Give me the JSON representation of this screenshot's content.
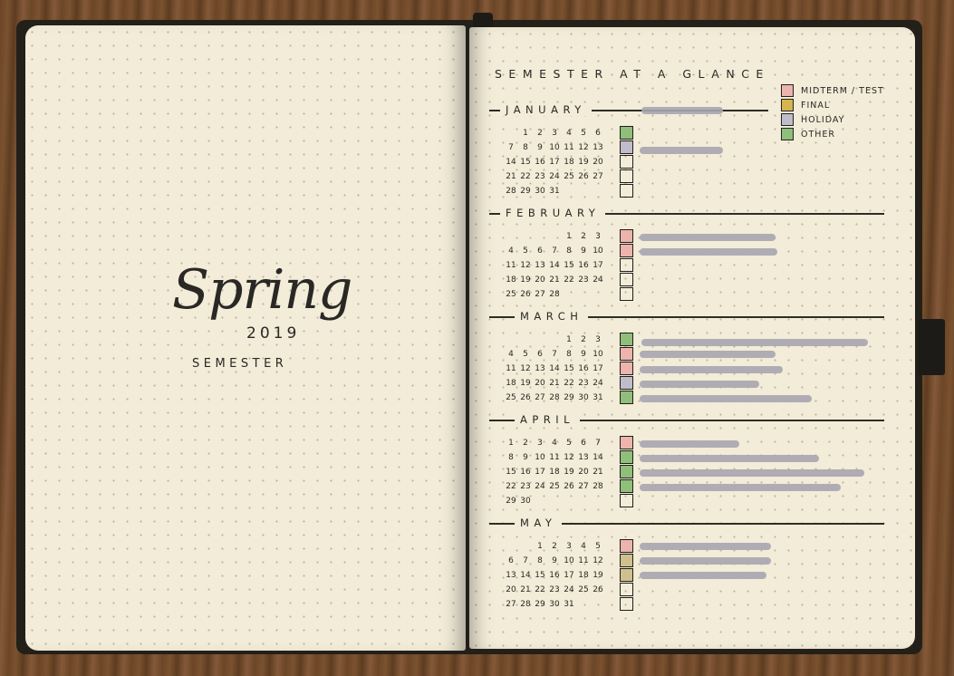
{
  "left_page": {
    "title_script": "Spring",
    "year": "2019",
    "subtitle": "SEMESTER"
  },
  "right_page": {
    "title": "SEMESTER AT A GLANCE",
    "legend": [
      {
        "label": "MIDTERM / TEST",
        "color": "#ecb4ad"
      },
      {
        "label": "FINAL",
        "color": "#d6b450"
      },
      {
        "label": "HOLIDAY",
        "color": "#c0bcc9"
      },
      {
        "label": "OTHER",
        "color": "#8fbf7a"
      }
    ],
    "months": [
      {
        "name": "JANUARY",
        "rows": [
          [
            "",
            "",
            "1",
            "2",
            "3",
            "4",
            "5",
            "6"
          ],
          [
            "7",
            "8",
            "9",
            "10",
            "11",
            "12",
            "13"
          ],
          [
            "14",
            "15",
            "16",
            "17",
            "18",
            "19",
            "20"
          ],
          [
            "21",
            "22",
            "23",
            "24",
            "25",
            "26",
            "27"
          ],
          [
            "28",
            "29",
            "30",
            "31",
            "",
            "",
            ""
          ]
        ],
        "boxes": [
          "#8fbf7a",
          "#c0bcc9",
          "",
          "",
          ""
        ]
      },
      {
        "name": "FEBRUARY",
        "rows": [
          [
            "",
            "",
            "",
            "",
            "1",
            "2",
            "3"
          ],
          [
            "4",
            "5",
            "6",
            "7",
            "8",
            "9",
            "10"
          ],
          [
            "11",
            "12",
            "13",
            "14",
            "15",
            "16",
            "17"
          ],
          [
            "18",
            "19",
            "20",
            "21",
            "22",
            "23",
            "24"
          ],
          [
            "25",
            "26",
            "27",
            "28",
            "",
            "",
            ""
          ]
        ],
        "boxes": [
          "#ecb4ad",
          "#ecb4ad",
          "",
          "",
          ""
        ]
      },
      {
        "name": "MARCH",
        "rows": [
          [
            "",
            "",
            "",
            "",
            "1",
            "2",
            "3"
          ],
          [
            "4",
            "5",
            "6",
            "7",
            "8",
            "9",
            "10"
          ],
          [
            "11",
            "12",
            "13",
            "14",
            "15",
            "16",
            "17"
          ],
          [
            "18",
            "19",
            "20",
            "21",
            "22",
            "23",
            "24"
          ],
          [
            "25",
            "26",
            "27",
            "28",
            "29",
            "30",
            "31"
          ]
        ],
        "boxes": [
          "#8fbf7a",
          "#ecb4ad",
          "#ecb4ad",
          "#c0bcc9",
          "#8fbf7a"
        ]
      },
      {
        "name": "APRIL",
        "rows": [
          [
            "1",
            "2",
            "3",
            "4",
            "5",
            "6",
            "7"
          ],
          [
            "8",
            "9",
            "10",
            "11",
            "12",
            "13",
            "14"
          ],
          [
            "15",
            "16",
            "17",
            "18",
            "19",
            "20",
            "21"
          ],
          [
            "22",
            "23",
            "24",
            "25",
            "26",
            "27",
            "28"
          ],
          [
            "29",
            "30",
            "",
            "",
            "",
            "",
            ""
          ]
        ],
        "boxes": [
          "#ecb4ad",
          "#8fbf7a",
          "#8fbf7a",
          "#8fbf7a",
          ""
        ]
      },
      {
        "name": "MAY",
        "rows": [
          [
            "",
            "",
            "1",
            "2",
            "3",
            "4",
            "5"
          ],
          [
            "6",
            "7",
            "8",
            "9",
            "10",
            "11",
            "12"
          ],
          [
            "13",
            "14",
            "15",
            "16",
            "17",
            "18",
            "19"
          ],
          [
            "20",
            "21",
            "22",
            "23",
            "24",
            "25",
            "26"
          ],
          [
            "27",
            "28",
            "29",
            "30",
            "31",
            "",
            ""
          ]
        ],
        "boxes": [
          "#ecb4ad",
          "#cfc08e",
          "#cfc08e",
          "",
          ""
        ]
      }
    ]
  }
}
